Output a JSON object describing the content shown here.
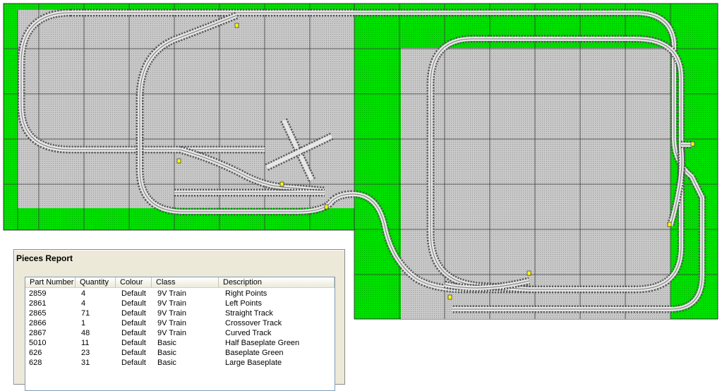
{
  "colors": {
    "baseplate_green": "#00e600",
    "baseplate_gray": "#c6c6c6",
    "grid_line": "#333333",
    "track_rail": "#6b6b6b",
    "track_bed": "#e8e8e8",
    "point_marker": "#ffff00"
  },
  "report": {
    "title": "Pieces Report",
    "columns": [
      "Part Number",
      "Quantity",
      "Colour",
      "Class",
      "Description"
    ],
    "rows": [
      {
        "part": "2859",
        "qty": "4",
        "colour": "Default",
        "cls": "9V Train",
        "desc": "Right Points"
      },
      {
        "part": "2861",
        "qty": "4",
        "colour": "Default",
        "cls": "9V Train",
        "desc": "Left Points"
      },
      {
        "part": "2865",
        "qty": "71",
        "colour": "Default",
        "cls": "9V Train",
        "desc": "Straight Track"
      },
      {
        "part": "2866",
        "qty": "1",
        "colour": "Default",
        "cls": "9V Train",
        "desc": "Crossover Track"
      },
      {
        "part": "2867",
        "qty": "48",
        "colour": "Default",
        "cls": "9V Train",
        "desc": "Curved Track"
      },
      {
        "part": "5010",
        "qty": "11",
        "colour": "Default",
        "cls": "Basic",
        "desc": "Half Baseplate Green"
      },
      {
        "part": "626",
        "qty": "23",
        "colour": "Default",
        "cls": "Basic",
        "desc": "Baseplate Green"
      },
      {
        "part": "628",
        "qty": "31",
        "colour": "Default",
        "cls": "Basic",
        "desc": "Large Baseplate"
      }
    ]
  }
}
